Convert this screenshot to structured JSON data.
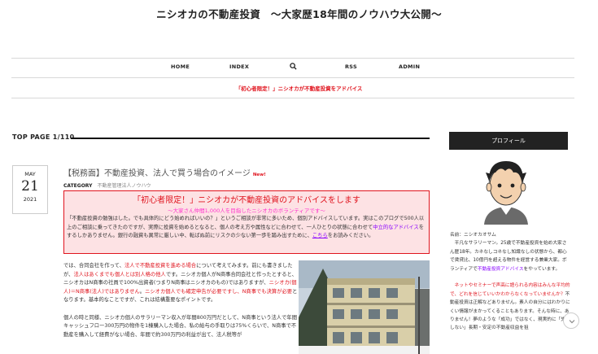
{
  "site": {
    "title": "ニシオカの不動産投資　〜大家歴18年間のノウハウ大公開〜"
  },
  "nav": {
    "items": [
      {
        "label": "HOME"
      },
      {
        "label": "INDEX"
      },
      {
        "icon": "search-icon"
      },
      {
        "label": "RSS"
      },
      {
        "label": "ADMIN"
      }
    ]
  },
  "announcement": "「初心者限定！」ニシオカが不動産投資をアドバイス",
  "listing": {
    "top_page_label": "TOP PAGE  1/110"
  },
  "post": {
    "date": {
      "month": "MAY",
      "day": "21",
      "year": "2021"
    },
    "title": "【税務面】不動産投資、法人で買う場合のイメージ",
    "new_badge": "New!",
    "category_label": "CATEGORY",
    "category_value": "不動産管理法人ノウハウ",
    "ad": {
      "title": "「初心者限定！」ニシオカが不動産投資のアドバイスをします",
      "subtitle": "〜大家さん仲間1,000人を目指したニシオカのボランティアです〜",
      "body_1": "「不動産投資の勉強はした。でも具体的にどう始めればいいの？」というご相談が非常に多いため、個別アドバイスしています。実はこのブログで500人以上のご相談に乗ってきたのですが、実際に投資を始めるとなると、個人の考え方や属性などに合わせて、一人ひとりの状態に合わせて",
      "body_highlight": "中立的なアドバイス",
      "body_2": "をするしかありません。銀行の融資も異常に厳しい中、転ばぬ前にリスクの少ない第一歩を踏み出すために、",
      "body_link": "こちら",
      "body_3": "をお読みください。"
    },
    "paragraph_1": {
      "a": "では、合同会社を作って、",
      "b": "法人で不動産投資を進める場合",
      "c": "について考えてみます。前にも書きましたが、",
      "d": "法人はあくまでも個人とは別人格の他人",
      "e": "です。ニシオカ個人がN商事合同会社と作ったとすると、ニシオカはN商事の社員で100%出資者(つまりN商事はニシオカのもの)ではありますが、",
      "f": "ニシオカ(個人)＝N商事(法人)ではありません",
      "g": "。",
      "h": "ニシオカ個人でも確定申告が必要ですし、N商事でも決算が必要",
      "i": "となります。基本的なことですが、これは結構重要なポイントです。"
    },
    "paragraph_2": "個人の時と同様、ニシオカ個人のサラリーマン収入が年間800万円だとして、N商事という法人で年間キャッシュフロー300万円の物件を1棟購入した場合、私の給与の手取りは75%くらいで、N商事で不動産を購入して経費がない場合、年間で約300万円の利益が出て、法人税等が"
  },
  "sidebar": {
    "profile_header": "プロフィール",
    "name_line": "名前：ニシオカオサム",
    "bio_1": "　平凡なサラリーマン。25歳で不動産投資を始め大家さん歴18年。カネなしコネなし知識なしの状態から、都心で賃貸比、10億円を超える物件を経営する兼業大家。ボランティアで",
    "bio_1_link": "不動産投資アドバイス",
    "bio_1_end": "をやっています。",
    "bio_2_red": "　ネットやセミナーで声高に語られる内容はみんな平均的で、どれを信じていいかわからなくなっていませんか？",
    "bio_2": "不動産投資は正解などありません。素人の自分にはわかりにくい情報がまかってくることもあります。そんな時に、ありません！夢のような「成功」ではなく、現実的に「失敗しない」長期・安定の不動産収益を狙"
  }
}
